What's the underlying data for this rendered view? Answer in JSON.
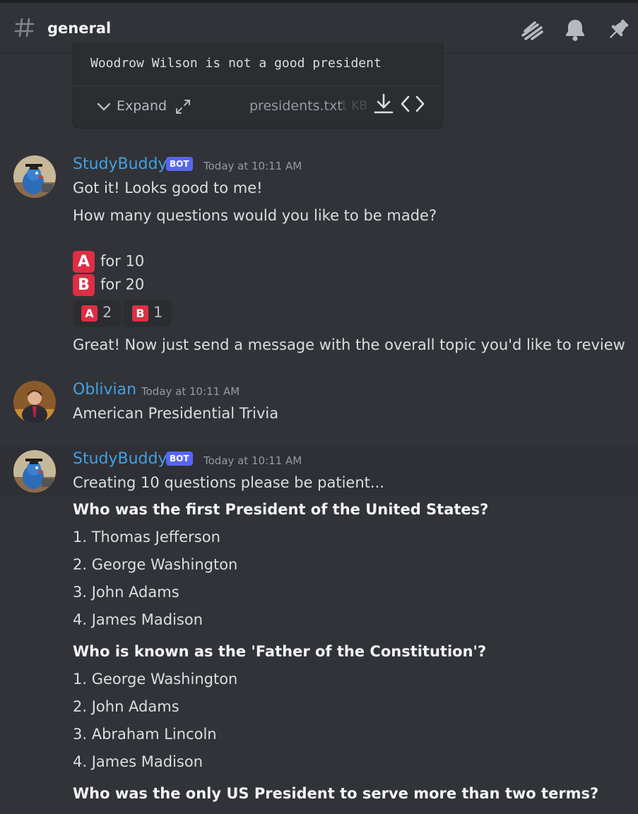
{
  "header": {
    "channel": "general"
  },
  "attachment": {
    "preview_line": "Woodrow Wilson is not a good president",
    "expand_label": "Expand",
    "filename": "presidents.txt",
    "filesize": "1 KB"
  },
  "messages": [
    {
      "author": "StudyBuddy",
      "badge": "BOT",
      "time": "Today at 10:11 AM",
      "lines": [
        "Got it! Looks good to me!",
        "How many questions would you like to be made?",
        "for 10",
        "for 20",
        "Great! Now just send a message with the overall topic you'd like to review"
      ],
      "options": [
        "A",
        "B"
      ],
      "reactions": [
        {
          "emoji": "A",
          "count": "2"
        },
        {
          "emoji": "B",
          "count": "1"
        }
      ]
    },
    {
      "author": "Oblivian",
      "time": "Today at 10:11 AM",
      "lines": [
        "American Presidential Trivia"
      ]
    },
    {
      "author": "StudyBuddy",
      "badge": "BOT",
      "time": "Today at 10:11 AM",
      "lines": [
        "Creating 10 questions please be patient..."
      ],
      "questions": [
        {
          "q": "Who was the first President of the United States?",
          "answers": [
            "1. Thomas Jefferson",
            "2. George Washington",
            "3. John Adams",
            "4. James Madison"
          ]
        },
        {
          "q": "Who is known as the 'Father of the Constitution'?",
          "answers": [
            "1. George Washington",
            "2. John Adams",
            "3. Abraham Lincoln",
            "4. James Madison"
          ]
        },
        {
          "q": "Who was the only US President to serve more than two terms?",
          "answers": []
        }
      ]
    }
  ],
  "colors": {
    "background": "#313338",
    "username": "#45a0e0",
    "bot_badge": "#5865f2",
    "emoji_red": "#dd2e44"
  },
  "icons": [
    "hash-icon",
    "threads-icon",
    "bell-icon",
    "pin-icon",
    "chevron-down-icon",
    "expand-icon",
    "download-icon",
    "code-icon"
  ]
}
